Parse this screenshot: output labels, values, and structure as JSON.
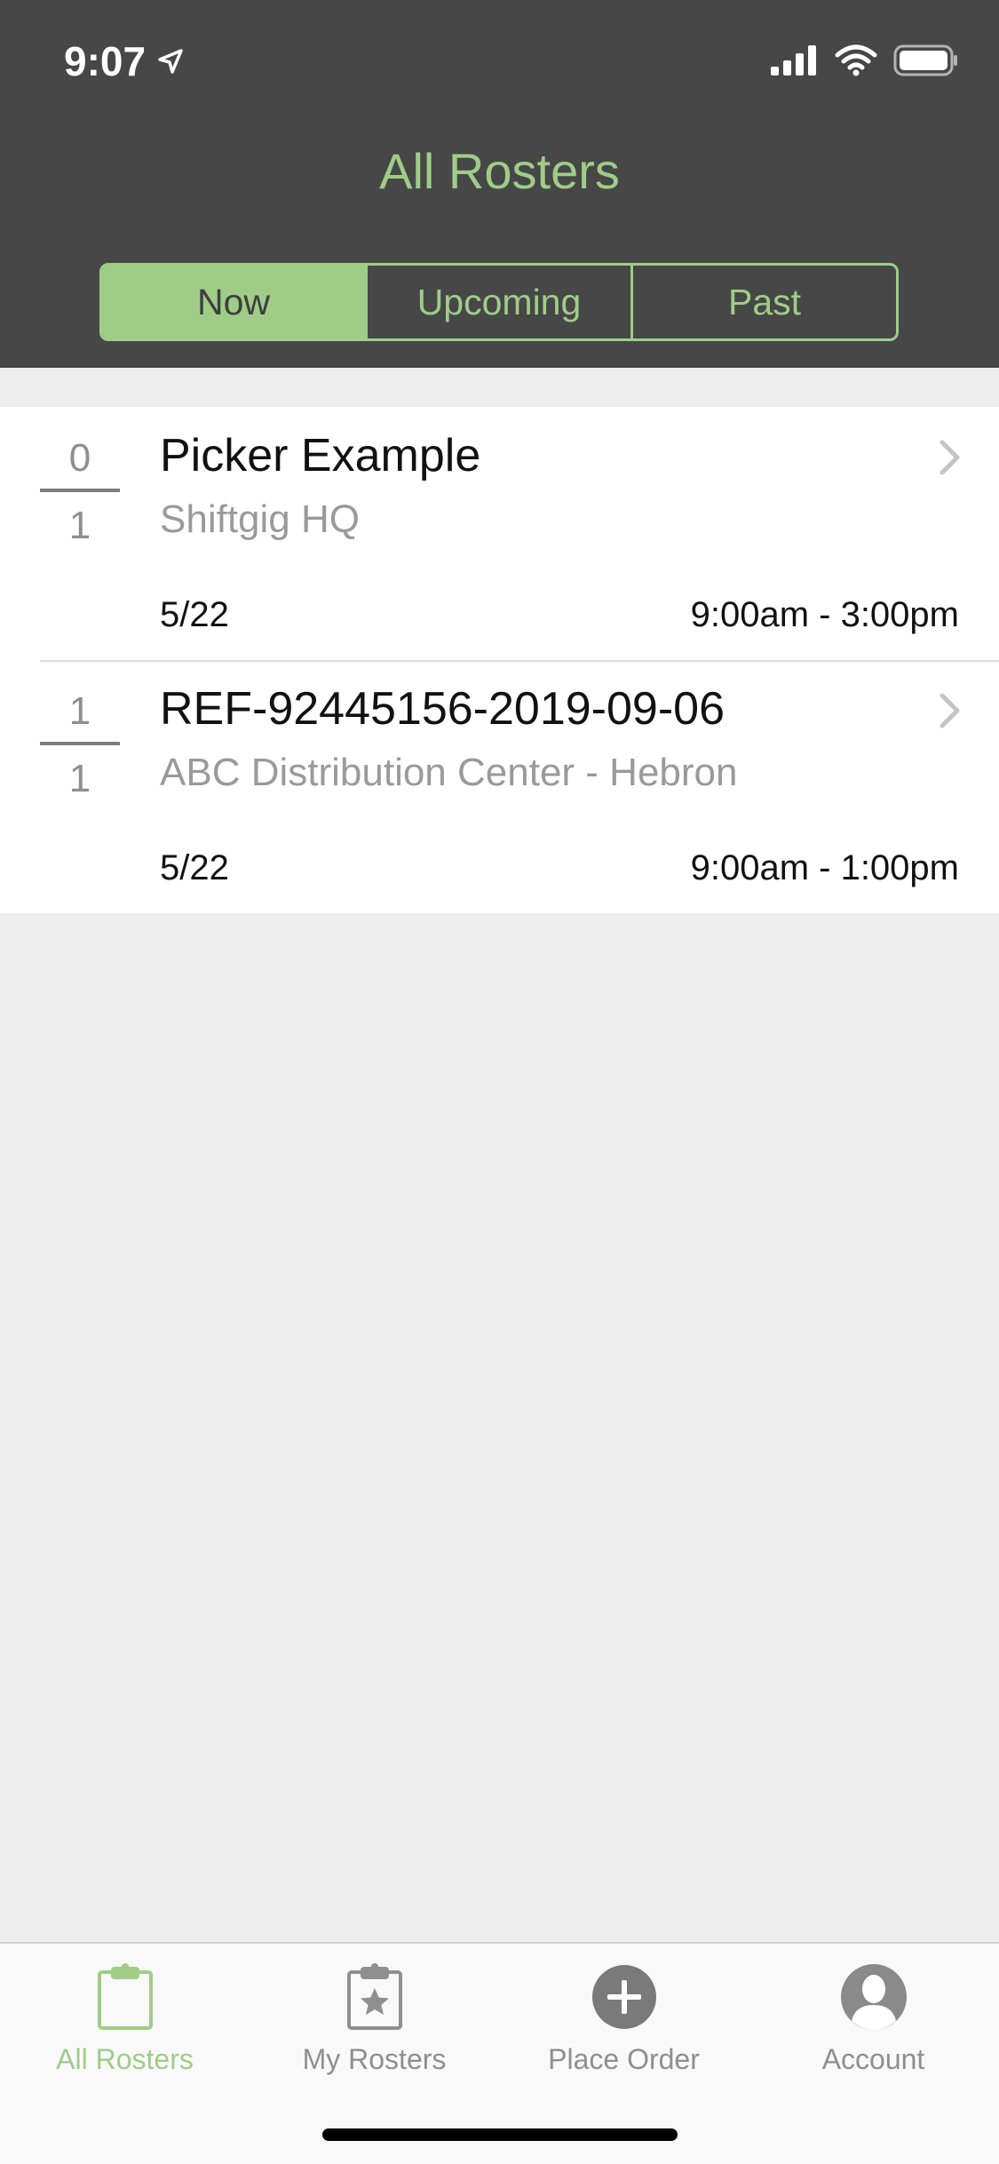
{
  "status_bar": {
    "time": "9:07"
  },
  "header": {
    "title": "All Rosters"
  },
  "segments": [
    {
      "label": "Now",
      "active": true
    },
    {
      "label": "Upcoming",
      "active": false
    },
    {
      "label": "Past",
      "active": false
    }
  ],
  "rosters": [
    {
      "filled": "0",
      "total": "1",
      "title": "Picker Example",
      "location": "Shiftgig HQ",
      "date": "5/22",
      "time": "9:00am - 3:00pm"
    },
    {
      "filled": "1",
      "total": "1",
      "title": "REF-92445156-2019-09-06",
      "location": "ABC Distribution Center - Hebron",
      "date": "5/22",
      "time": "9:00am - 1:00pm"
    }
  ],
  "tabbar": {
    "items": [
      {
        "label": "All Rosters",
        "icon": "clipboard-icon",
        "active": true
      },
      {
        "label": "My Rosters",
        "icon": "clipboard-star-icon",
        "active": false
      },
      {
        "label": "Place Order",
        "icon": "plus-circle-icon",
        "active": false
      },
      {
        "label": "Account",
        "icon": "account-icon",
        "active": false
      }
    ]
  },
  "colors": {
    "accent": "#9fcd88",
    "header_bg": "#474747",
    "page_bg": "#ededed"
  }
}
